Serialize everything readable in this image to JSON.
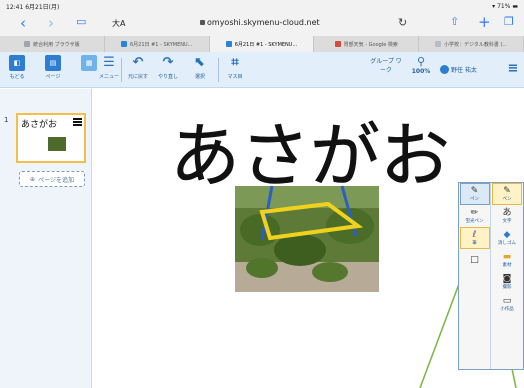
{
  "status": {
    "time": "12:41",
    "date": "6月21日(月)",
    "battery": "71%"
  },
  "browser": {
    "text_size": "大A",
    "url": "omyoshi.skymenu-cloud.net"
  },
  "tabs": [
    {
      "label": "統合利用 ブラウザ版",
      "active": false,
      "color": "#9ea7b0"
    },
    {
      "label": "6月21日 #1 - SKYMENU...",
      "active": false,
      "color": "#2a84d6"
    },
    {
      "label": "6月21日 #1 - SKYMENU...",
      "active": true,
      "color": "#2a84d6"
    },
    {
      "label": "胃部天気 - Google 検索",
      "active": false,
      "color": "#d94a3b"
    },
    {
      "label": "小学校：デジタル教科書 (...",
      "active": false,
      "color": "#b6bdc4"
    }
  ],
  "toolbar": {
    "back": "もどる",
    "page": "ページ",
    "menu": "メニュー",
    "undo": "元に戻す",
    "redo": "やり直し",
    "select": "選択",
    "grid": "マス目",
    "group_work": "グループ ワーク",
    "zoom": "100%",
    "user": "野任 祐太"
  },
  "sidebar": {
    "page_number": "1",
    "page_text": "あさがお",
    "add_page": "ページを追加"
  },
  "canvas": {
    "handwriting": "あさがお"
  },
  "palette": {
    "left": [
      {
        "label": "ペン",
        "icon": "pen-icon"
      },
      {
        "label": "蛍光ペン",
        "icon": "highlighter-icon"
      },
      {
        "label": "筆",
        "icon": "brush-icon"
      },
      {
        "label": "",
        "icon": "shape-icon"
      }
    ],
    "right": [
      {
        "label": "ペン",
        "icon": "pen-icon"
      },
      {
        "label": "文字",
        "icon": "text-icon"
      },
      {
        "label": "消しゴム",
        "icon": "eraser-icon"
      },
      {
        "label": "素材",
        "icon": "folder-icon"
      },
      {
        "label": "撮影",
        "icon": "camera-icon"
      },
      {
        "label": "小作品",
        "icon": "doc-icon"
      }
    ]
  },
  "colors": {
    "accent": "#2a7dd0",
    "toolbar_bg": "#e2eef9",
    "selected": "#f2c04a",
    "annotation_arrow": "#7fb84a"
  }
}
